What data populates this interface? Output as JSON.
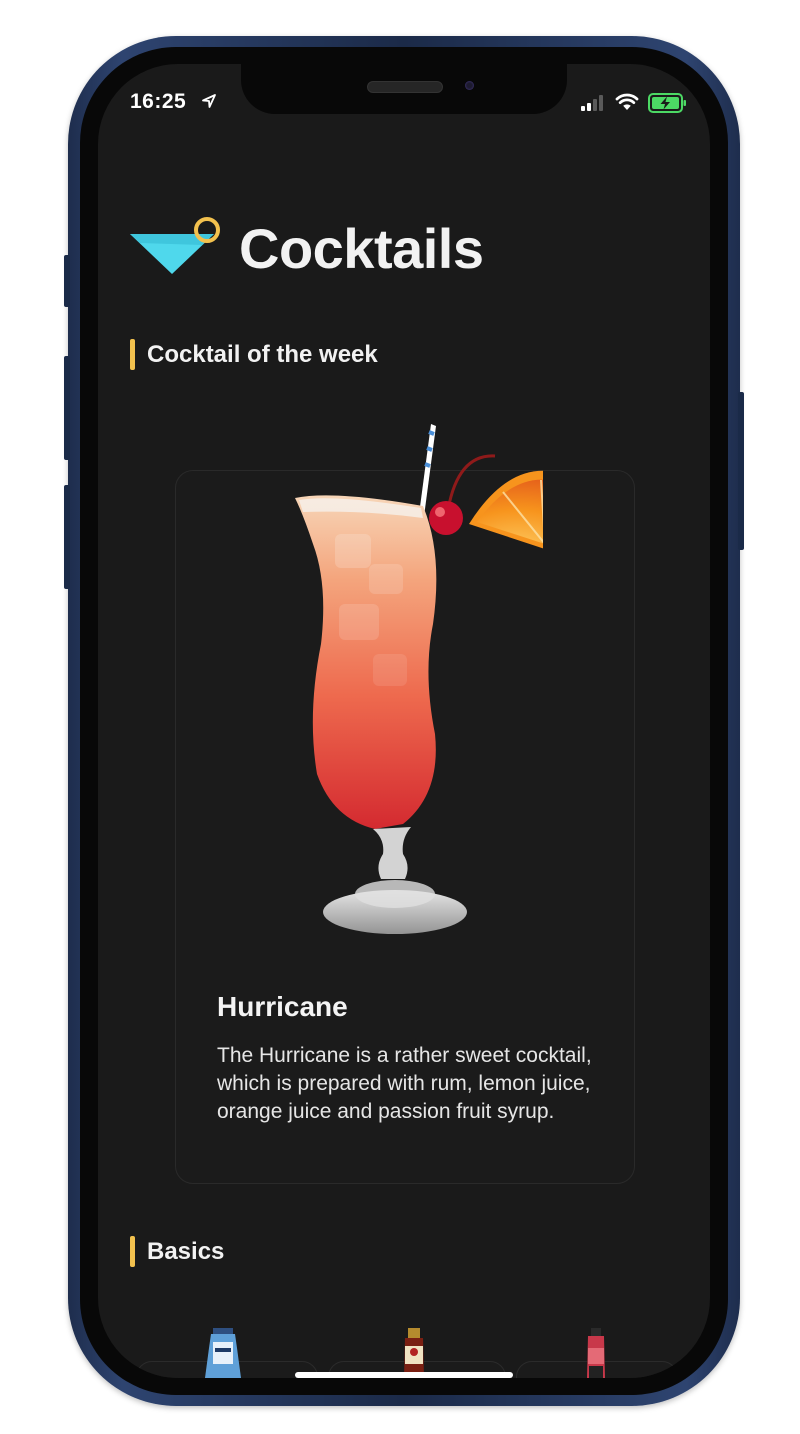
{
  "status_bar": {
    "time": "16:25",
    "icons": [
      "location-arrow-icon",
      "cellular-signal-icon",
      "wifi-icon",
      "battery-charging-icon"
    ]
  },
  "app": {
    "title": "Cocktails",
    "logo_icon": "cocktail-glass-icon"
  },
  "cocktail_of_week": {
    "section_title": "Cocktail of the week",
    "name": "Hurricane",
    "description": "The Hurricane is a rather sweet cocktail, which is prepared with rum, lemon juice, orange juice and passion fruit syrup."
  },
  "basics": {
    "section_title": "Basics",
    "items": [
      {
        "icon": "gin-bottle-icon"
      },
      {
        "icon": "rum-bottle-icon"
      },
      {
        "icon": "liqueur-bottle-icon"
      }
    ]
  },
  "colors": {
    "background": "#1a1a1a",
    "accent_bar": "#f2c14e",
    "logo_cyan": "#4fd8ec",
    "text_primary": "#f2f2f2",
    "battery_green": "#4cd964"
  }
}
